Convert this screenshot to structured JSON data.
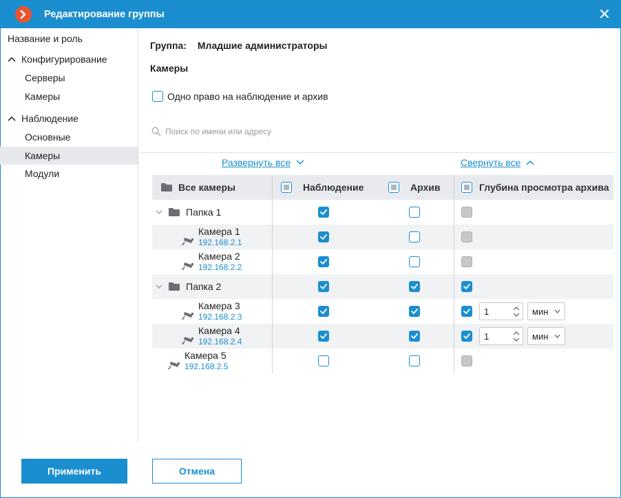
{
  "window": {
    "title": "Редактирование группы"
  },
  "sidebar": {
    "name_role": "Название и роль",
    "config_group": "Конфигурирование",
    "config_items": [
      "Серверы",
      "Камеры"
    ],
    "watch_group": "Наблюдение",
    "watch_items": [
      "Основные",
      "Камеры",
      "Модули"
    ],
    "active_item": "Камеры"
  },
  "main": {
    "group_label": "Группа:",
    "group_value": "Младшие администраторы",
    "section_title": "Камеры",
    "single_right_label": "Одно право на наблюдение и архив",
    "search_placeholder": "Поиск по имени или адресу",
    "expand_all": "Развернуть все",
    "collapse_all": "Свернуть все"
  },
  "table": {
    "headers": {
      "all_cameras": "Все камеры",
      "watch": "Наблюдение",
      "archive": "Архив",
      "depth": "Глубина просмотра архива"
    },
    "rows": [
      {
        "type": "folder",
        "name": "Папка 1",
        "watch": "checked",
        "archive": "unchecked",
        "depth": "disabled"
      },
      {
        "type": "camera",
        "name": "Камера 1",
        "ip": "192.168.2.1",
        "watch": "checked",
        "archive": "unchecked",
        "depth": "disabled"
      },
      {
        "type": "camera",
        "name": "Камера 2",
        "ip": "192.168.2.2",
        "watch": "checked",
        "archive": "unchecked",
        "depth": "disabled"
      },
      {
        "type": "folder",
        "name": "Папка 2",
        "watch": "checked",
        "archive": "checked",
        "depth": "checked"
      },
      {
        "type": "camera",
        "name": "Камера 3",
        "ip": "192.168.2.3",
        "watch": "checked",
        "archive": "checked",
        "depth": "checked",
        "depth_value": "1",
        "depth_unit": "мин"
      },
      {
        "type": "camera",
        "name": "Камера 4",
        "ip": "192.168.2.4",
        "watch": "checked",
        "archive": "checked",
        "depth": "checked",
        "depth_value": "1",
        "depth_unit": "мин"
      },
      {
        "type": "camera_root",
        "name": "Камера 5",
        "ip": "192.168.2.5",
        "watch": "unchecked",
        "archive": "unchecked",
        "depth": "disabled"
      }
    ]
  },
  "footer": {
    "apply": "Применить",
    "cancel": "Отмена"
  },
  "colors": {
    "accent": "#1b8ecf",
    "logo": "#e8542e",
    "active_bg": "#e6e8ec"
  }
}
